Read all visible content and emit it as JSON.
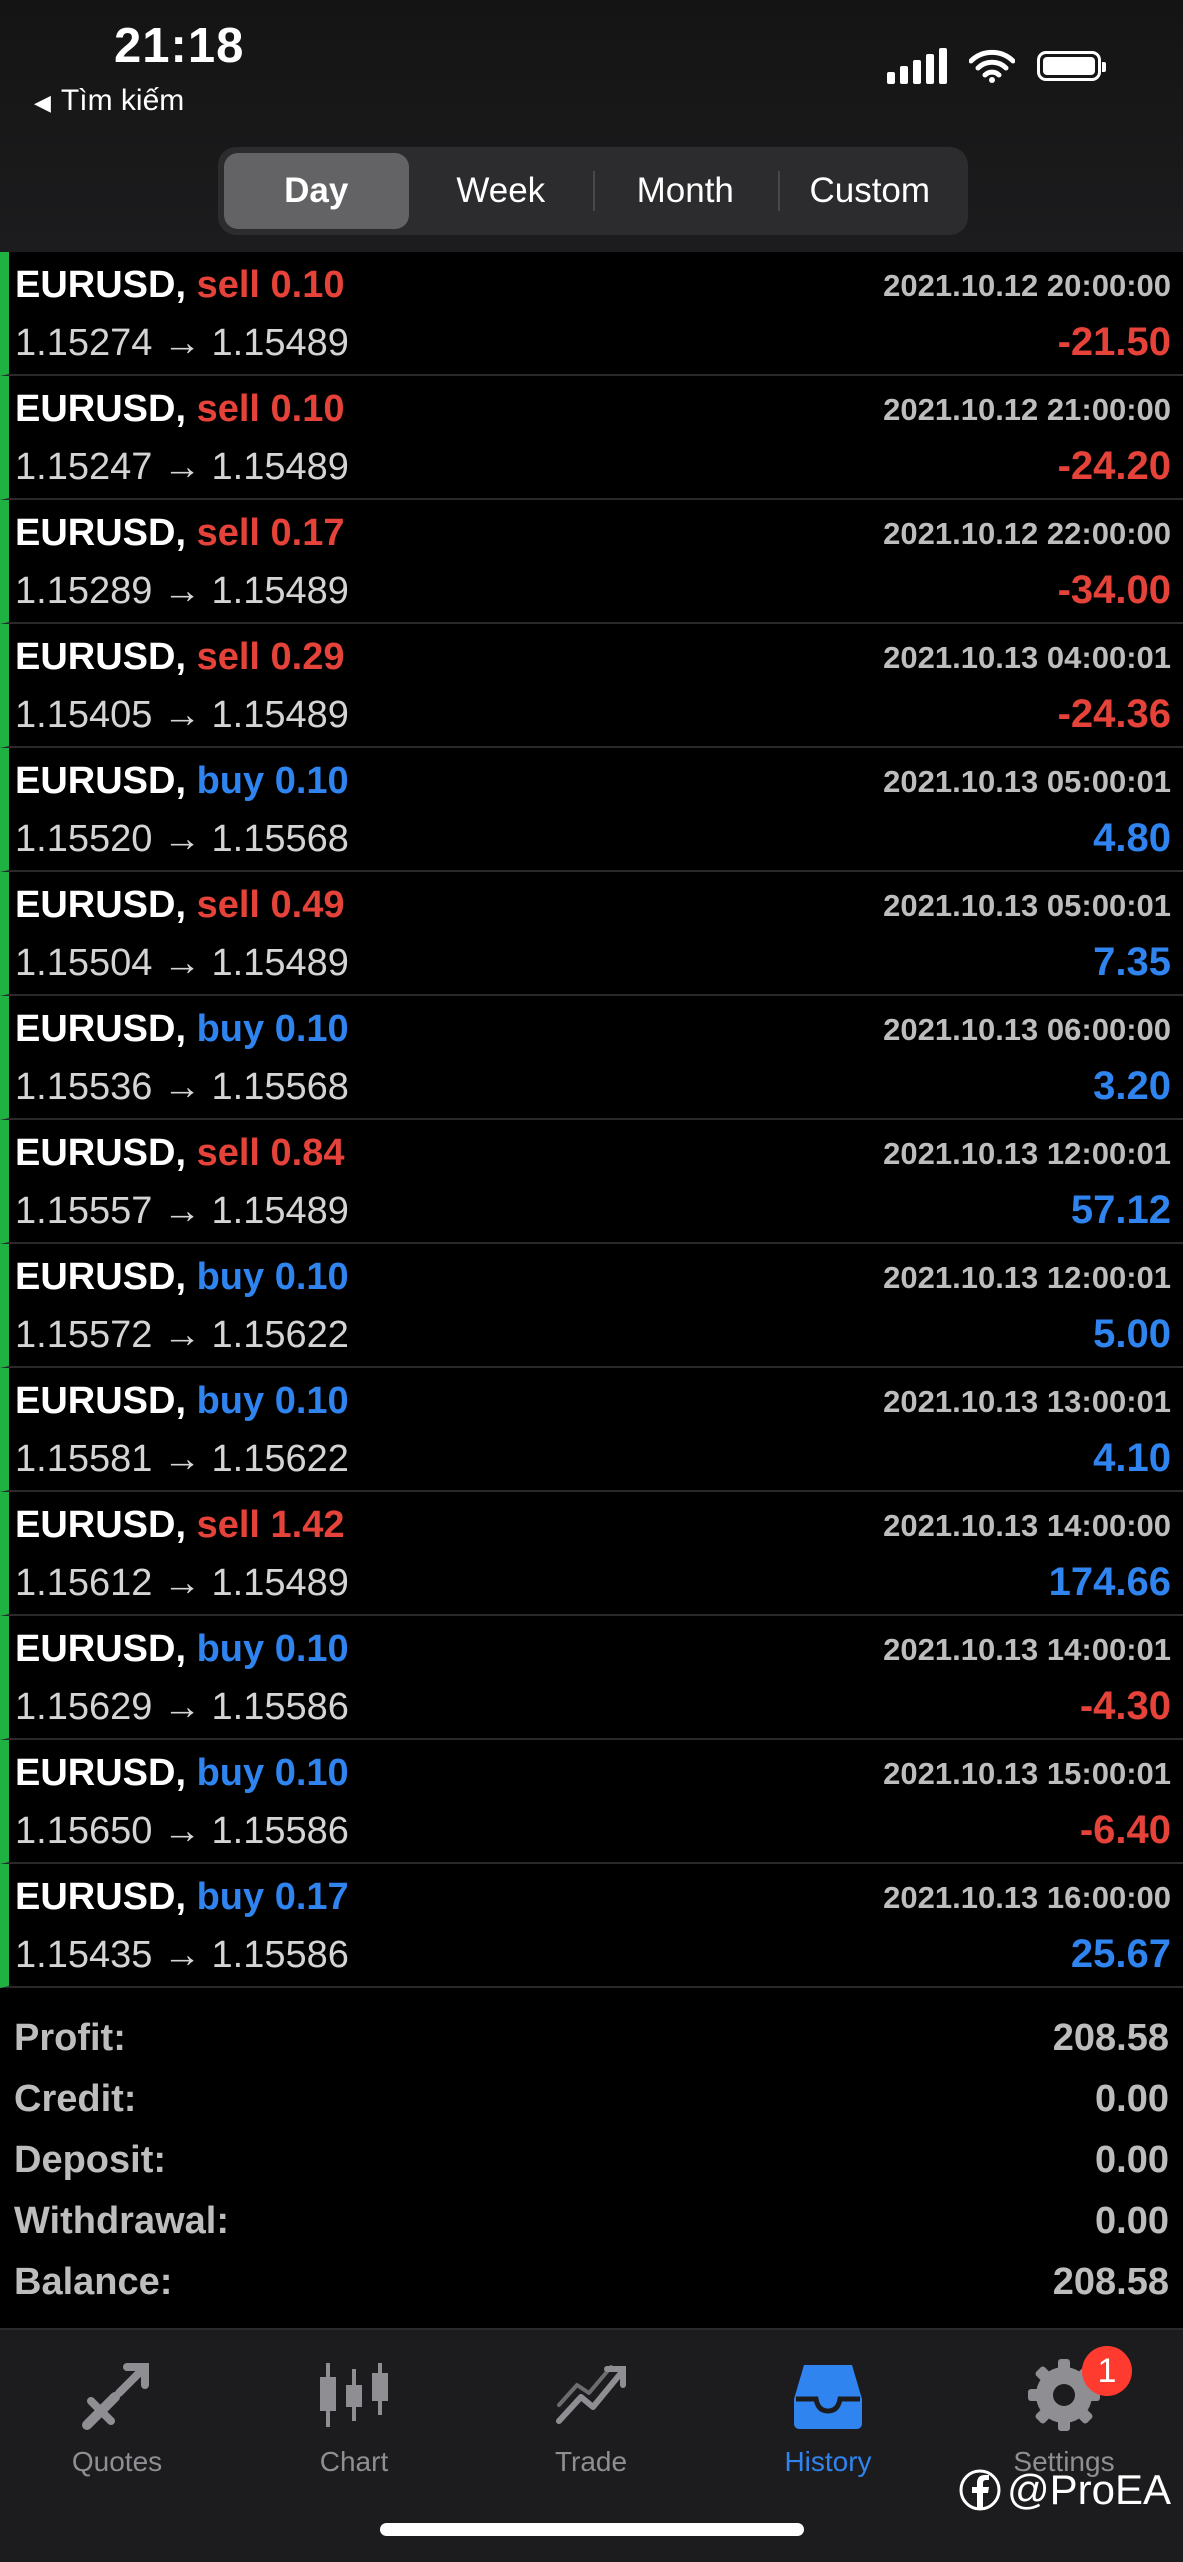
{
  "status": {
    "time": "21:18",
    "back_label": "Tìm kiếm"
  },
  "segments": [
    {
      "label": "Day",
      "active": true
    },
    {
      "label": "Week",
      "active": false
    },
    {
      "label": "Month",
      "active": false
    },
    {
      "label": "Custom",
      "active": false
    }
  ],
  "deals": [
    {
      "symbol": "EURUSD,",
      "side": "sell",
      "volume": "0.10",
      "open": "1.15274",
      "close": "1.15489",
      "time": "2021.10.12 20:00:00",
      "profit": "-21.50"
    },
    {
      "symbol": "EURUSD,",
      "side": "sell",
      "volume": "0.10",
      "open": "1.15247",
      "close": "1.15489",
      "time": "2021.10.12 21:00:00",
      "profit": "-24.20"
    },
    {
      "symbol": "EURUSD,",
      "side": "sell",
      "volume": "0.17",
      "open": "1.15289",
      "close": "1.15489",
      "time": "2021.10.12 22:00:00",
      "profit": "-34.00"
    },
    {
      "symbol": "EURUSD,",
      "side": "sell",
      "volume": "0.29",
      "open": "1.15405",
      "close": "1.15489",
      "time": "2021.10.13 04:00:01",
      "profit": "-24.36"
    },
    {
      "symbol": "EURUSD,",
      "side": "buy",
      "volume": "0.10",
      "open": "1.15520",
      "close": "1.15568",
      "time": "2021.10.13 05:00:01",
      "profit": "4.80"
    },
    {
      "symbol": "EURUSD,",
      "side": "sell",
      "volume": "0.49",
      "open": "1.15504",
      "close": "1.15489",
      "time": "2021.10.13 05:00:01",
      "profit": "7.35"
    },
    {
      "symbol": "EURUSD,",
      "side": "buy",
      "volume": "0.10",
      "open": "1.15536",
      "close": "1.15568",
      "time": "2021.10.13 06:00:00",
      "profit": "3.20"
    },
    {
      "symbol": "EURUSD,",
      "side": "sell",
      "volume": "0.84",
      "open": "1.15557",
      "close": "1.15489",
      "time": "2021.10.13 12:00:01",
      "profit": "57.12"
    },
    {
      "symbol": "EURUSD,",
      "side": "buy",
      "volume": "0.10",
      "open": "1.15572",
      "close": "1.15622",
      "time": "2021.10.13 12:00:01",
      "profit": "5.00"
    },
    {
      "symbol": "EURUSD,",
      "side": "buy",
      "volume": "0.10",
      "open": "1.15581",
      "close": "1.15622",
      "time": "2021.10.13 13:00:01",
      "profit": "4.10"
    },
    {
      "symbol": "EURUSD,",
      "side": "sell",
      "volume": "1.42",
      "open": "1.15612",
      "close": "1.15489",
      "time": "2021.10.13 14:00:00",
      "profit": "174.66"
    },
    {
      "symbol": "EURUSD,",
      "side": "buy",
      "volume": "0.10",
      "open": "1.15629",
      "close": "1.15586",
      "time": "2021.10.13 14:00:01",
      "profit": "-4.30"
    },
    {
      "symbol": "EURUSD,",
      "side": "buy",
      "volume": "0.10",
      "open": "1.15650",
      "close": "1.15586",
      "time": "2021.10.13 15:00:01",
      "profit": "-6.40"
    },
    {
      "symbol": "EURUSD,",
      "side": "buy",
      "volume": "0.17",
      "open": "1.15435",
      "close": "1.15586",
      "time": "2021.10.13 16:00:00",
      "profit": "25.67"
    }
  ],
  "summary": [
    {
      "label": "Profit:",
      "value": "208.58"
    },
    {
      "label": "Credit:",
      "value": "0.00"
    },
    {
      "label": "Deposit:",
      "value": "0.00"
    },
    {
      "label": "Withdrawal:",
      "value": "0.00"
    },
    {
      "label": "Balance:",
      "value": "208.58"
    }
  ],
  "tabs": [
    {
      "label": "Quotes",
      "icon": "quotes-icon"
    },
    {
      "label": "Chart",
      "icon": "chart-icon"
    },
    {
      "label": "Trade",
      "icon": "trade-icon"
    },
    {
      "label": "History",
      "icon": "history-icon",
      "active": true
    },
    {
      "label": "Settings",
      "icon": "settings-icon",
      "badge": "1"
    }
  ],
  "watermark": "@ProEA",
  "colors": {
    "sell": "#e5423a",
    "buy": "#2f84f0",
    "accent": "#2f84f0",
    "row_marker": "#1fb141"
  }
}
